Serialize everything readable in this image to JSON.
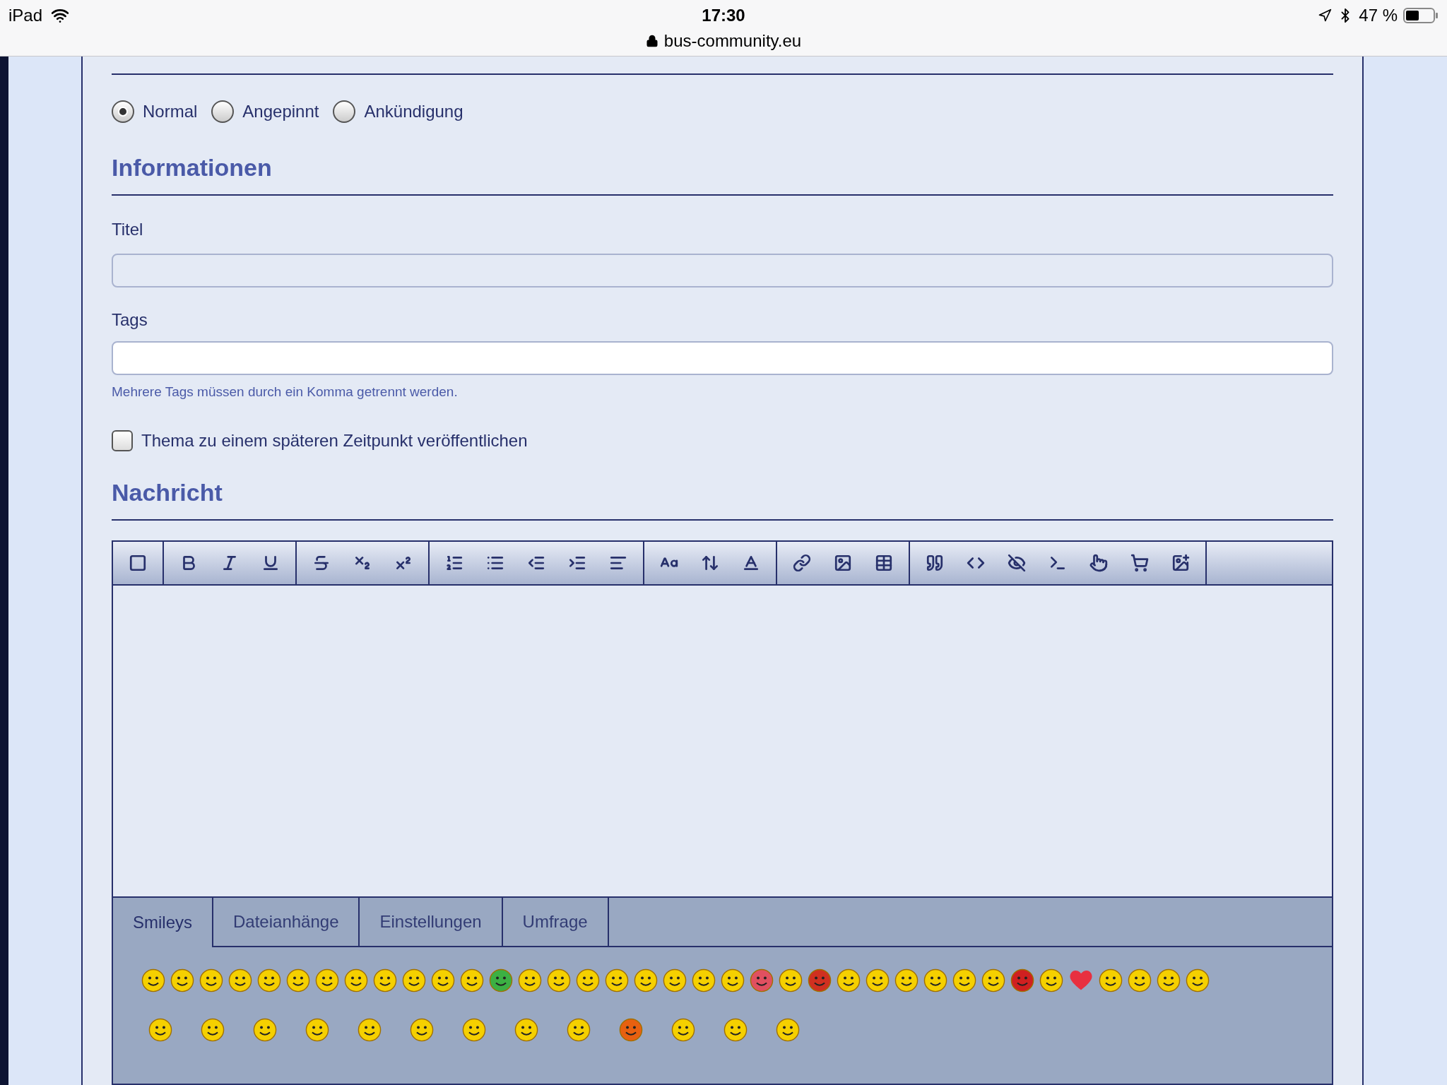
{
  "status_bar": {
    "device": "iPad",
    "time": "17:30",
    "url": "bus-community.eu",
    "battery": "47 %"
  },
  "thread_status": {
    "options": [
      {
        "label": "Normal",
        "selected": true
      },
      {
        "label": "Angepinnt",
        "selected": false
      },
      {
        "label": "Ankündigung",
        "selected": false
      }
    ]
  },
  "informationen": {
    "heading": "Informationen",
    "title_label": "Titel",
    "tags_label": "Tags",
    "tags_hint": "Mehrere Tags müssen durch ein Komma getrennt werden.",
    "schedule": {
      "label": "Thema zu einem späteren Zeitpunkt veröffentlichen",
      "checked": false
    }
  },
  "nachricht": {
    "heading": "Nachricht",
    "tabs": [
      {
        "label": "Smileys",
        "selected": true
      },
      {
        "label": "Dateianhänge",
        "selected": false
      },
      {
        "label": "Einstellungen",
        "selected": false
      },
      {
        "label": "Umfrage",
        "selected": false
      }
    ]
  }
}
